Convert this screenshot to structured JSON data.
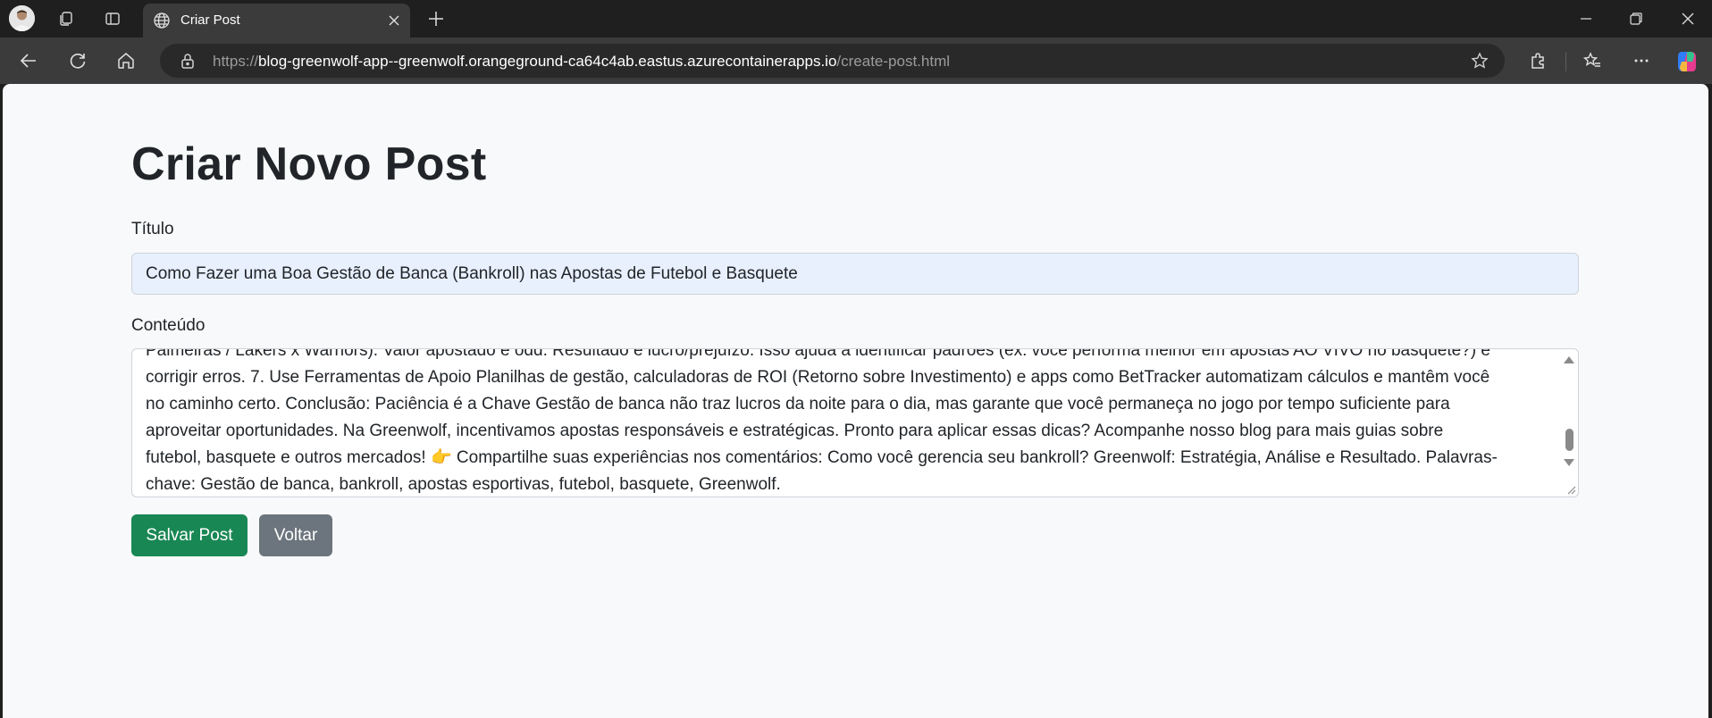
{
  "browser": {
    "tab_title": "Criar Post",
    "url": {
      "scheme": "https://",
      "host": "blog-greenwolf-app--greenwolf.orangeground-ca64c4ab.eastus.azurecontainerapps.io",
      "path": "/create-post.html"
    }
  },
  "page": {
    "heading": "Criar Novo Post",
    "title_label": "Título",
    "title_value": "Como Fazer uma Boa Gestão de Banca (Bankroll) nas Apostas de Futebol e Basquete",
    "content_label": "Conteúdo",
    "content_lines": [
      "Palmeiras / Lakers x Warriors). Valor apostado e odd. Resultado e lucro/prejuízo. Isso ajuda a identificar padrões (ex: você performa melhor em apostas AO VIVO no basquete?) e",
      "corrigir erros. 7. Use Ferramentas de Apoio Planilhas de gestão, calculadoras de ROI (Retorno sobre Investimento) e apps como BetTracker automatizam cálculos e mantêm você",
      "no caminho certo. Conclusão: Paciência é a Chave Gestão de banca não traz lucros da noite para o dia, mas garante que você permaneça no jogo por tempo suficiente para",
      "aproveitar oportunidades. Na Greenwolf, incentivamos apostas responsáveis e estratégicas. Pronto para aplicar essas dicas? Acompanhe nosso blog para mais guias sobre",
      "futebol, basquete e outros mercados! 👉 Compartilhe suas experiências nos comentários: Como você gerencia seu bankroll? Greenwolf: Estratégia, Análise e Resultado. Palavras-",
      "chave: Gestão de banca, bankroll, apostas esportivas, futebol, basquete, Greenwolf."
    ],
    "save_button": "Salvar Post",
    "back_button": "Voltar"
  },
  "colors": {
    "save_button": "#198754",
    "back_button": "#6c757d",
    "title_input_bg": "#e8f0fe"
  },
  "icons": [
    "profile-avatar",
    "collections-icon",
    "tab-actions-icon",
    "globe-icon",
    "close-icon",
    "plus-icon",
    "minimize-icon",
    "restore-icon",
    "close-window-icon",
    "back-arrow-icon",
    "refresh-icon",
    "home-icon",
    "lock-icon",
    "star-icon",
    "extensions-icon",
    "favorites-icon",
    "more-icon",
    "copilot-icon"
  ]
}
